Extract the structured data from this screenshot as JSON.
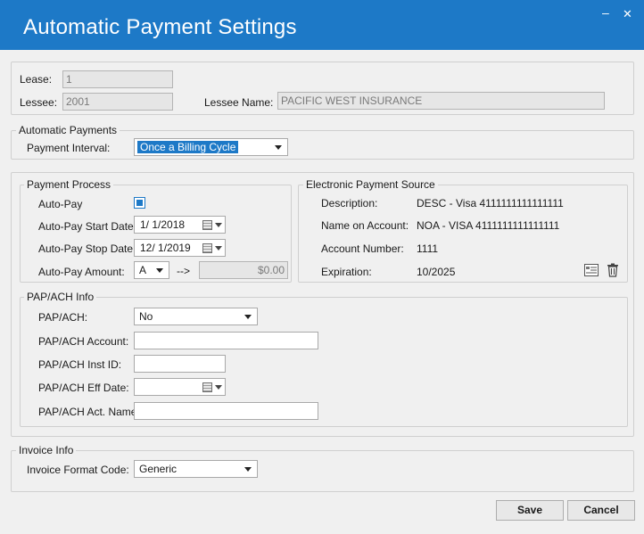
{
  "window": {
    "title": "Automatic Payment Settings",
    "minimize_glyph": "–",
    "close_glyph": "✕"
  },
  "lease": {
    "lease_label": "Lease:",
    "lease_value": "1",
    "lessee_label": "Lessee:",
    "lessee_value": "2001",
    "lessee_name_label": "Lessee Name:",
    "lessee_name_value": "PACIFIC WEST INSURANCE"
  },
  "automatic_payments": {
    "legend": "Automatic Payments",
    "interval_label": "Payment Interval:",
    "interval_value": "Once a Billing Cycle"
  },
  "payment_process": {
    "legend": "Payment Process",
    "autopay_label": "Auto-Pay",
    "autopay_checked": true,
    "start_label": "Auto-Pay Start Date:",
    "start_value": "1/ 1/2018",
    "stop_label": "Auto-Pay Stop Date:",
    "stop_value": "12/ 1/2019",
    "amount_label": "Auto-Pay Amount:",
    "amount_mode": "A",
    "arrow_text": "-->",
    "amount_value": "$0.00"
  },
  "electronic_source": {
    "legend": "Electronic Payment Source",
    "description_label": "Description:",
    "description_value": "DESC - Visa 4111111111111111",
    "name_label": "Name on Account:",
    "name_value": "NOA - VISA 4111111111111111",
    "account_label": "Account Number:",
    "account_value": "1111",
    "expiration_label": "Expiration:",
    "expiration_value": "10/2025"
  },
  "pap": {
    "legend": "PAP/ACH Info",
    "pap_label": "PAP/ACH:",
    "pap_value": "No",
    "account_label": "PAP/ACH Account:",
    "account_value": "",
    "inst_label": "PAP/ACH Inst ID:",
    "inst_value": "",
    "eff_label": "PAP/ACH Eff Date:",
    "eff_value": "",
    "act_name_label": "PAP/ACH Act. Name:",
    "act_name_value": ""
  },
  "invoice": {
    "legend": "Invoice Info",
    "format_label": "Invoice Format Code:",
    "format_value": "Generic"
  },
  "buttons": {
    "save": "Save",
    "cancel": "Cancel"
  },
  "colors": {
    "accent": "#1d79c7",
    "readonly_bg": "#e6e6e6"
  }
}
